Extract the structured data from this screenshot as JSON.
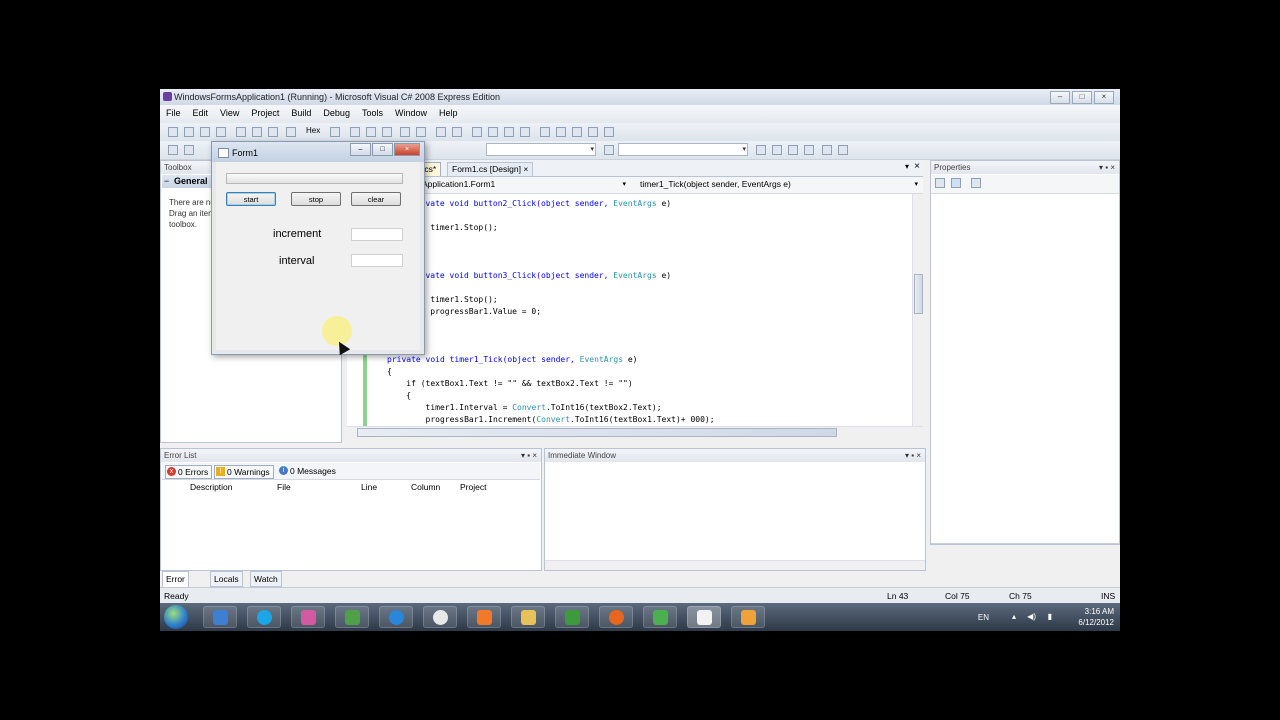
{
  "vs": {
    "title": "WindowsFormsApplication1 (Running) - Microsoft Visual C# 2008 Express Edition",
    "menu": [
      "File",
      "Edit",
      "View",
      "Project",
      "Build",
      "Debug",
      "Tools",
      "Window",
      "Help"
    ],
    "toolbar_hex": "Hex"
  },
  "toolbox": {
    "title": "Toolbox",
    "group": "General",
    "message": "There are no usable controls in this group. Drag an item onto this text to add it to the toolbox."
  },
  "editor": {
    "tabs": [
      ".cs*",
      "Form1.cs [Design]"
    ],
    "nav_left": "Application1.Form1",
    "nav_right": "timer1_Tick(object sender, EventArgs e)",
    "code": [
      {
        "pre": "private void button2_Click(object sender, ",
        "type": "EventArgs",
        "post": " e)"
      },
      {
        "pre": "    timer1.Stop();",
        "type": "",
        "post": ""
      },
      {
        "pre": "private void button3_Click(object sender, ",
        "type": "EventArgs",
        "post": " e)"
      },
      {
        "pre": "    timer1.Stop();",
        "type": "",
        "post": ""
      },
      {
        "pre": "    progressBar1.Value = 0;",
        "type": "",
        "post": ""
      },
      {
        "pre": "private void timer1_Tick(object sender, ",
        "type": "EventArgs",
        "post": " e)"
      },
      {
        "pre": "{",
        "type": "",
        "post": ""
      },
      {
        "pre": "    if (textBox1.Text != \"\" && textBox2.Text != \"\")",
        "type": "",
        "post": ""
      },
      {
        "pre": "    {",
        "type": "",
        "post": ""
      },
      {
        "pre": "        timer1.Interval = ",
        "type": "Convert",
        "post": ".ToInt16(textBox2.Text);"
      },
      {
        "pre": "        progressBar1.Increment(",
        "type": "Convert",
        "post": ".ToInt16(textBox1.Text)+ 000);"
      }
    ]
  },
  "properties": {
    "title": "Properties"
  },
  "error_list": {
    "title": "Error List",
    "errors": "0 Errors",
    "warnings": "0 Warnings",
    "messages": "0 Messages",
    "columns": [
      "Description",
      "File",
      "Line",
      "Column",
      "Project"
    ]
  },
  "immediate": {
    "title": "Immediate Window"
  },
  "bottom_tabs": [
    "Error List",
    "Locals",
    "Watch"
  ],
  "status": {
    "left": "Ready",
    "ln": "Ln 43",
    "col": "Col 75",
    "ch": "Ch 75",
    "mode": "INS"
  },
  "tray": {
    "lang": "EN",
    "time": "3:16 AM",
    "date": "6/12/2012"
  },
  "form1": {
    "title": "Form1",
    "progress": 0,
    "buttons": [
      "start",
      "stop",
      "clear"
    ],
    "label_increment": "increment",
    "label_interval": "interval",
    "increment_value": "",
    "interval_value": ""
  },
  "colors": {
    "accent": "#3c7fb1",
    "keyword": "#0000ff",
    "type": "#2b91af"
  }
}
